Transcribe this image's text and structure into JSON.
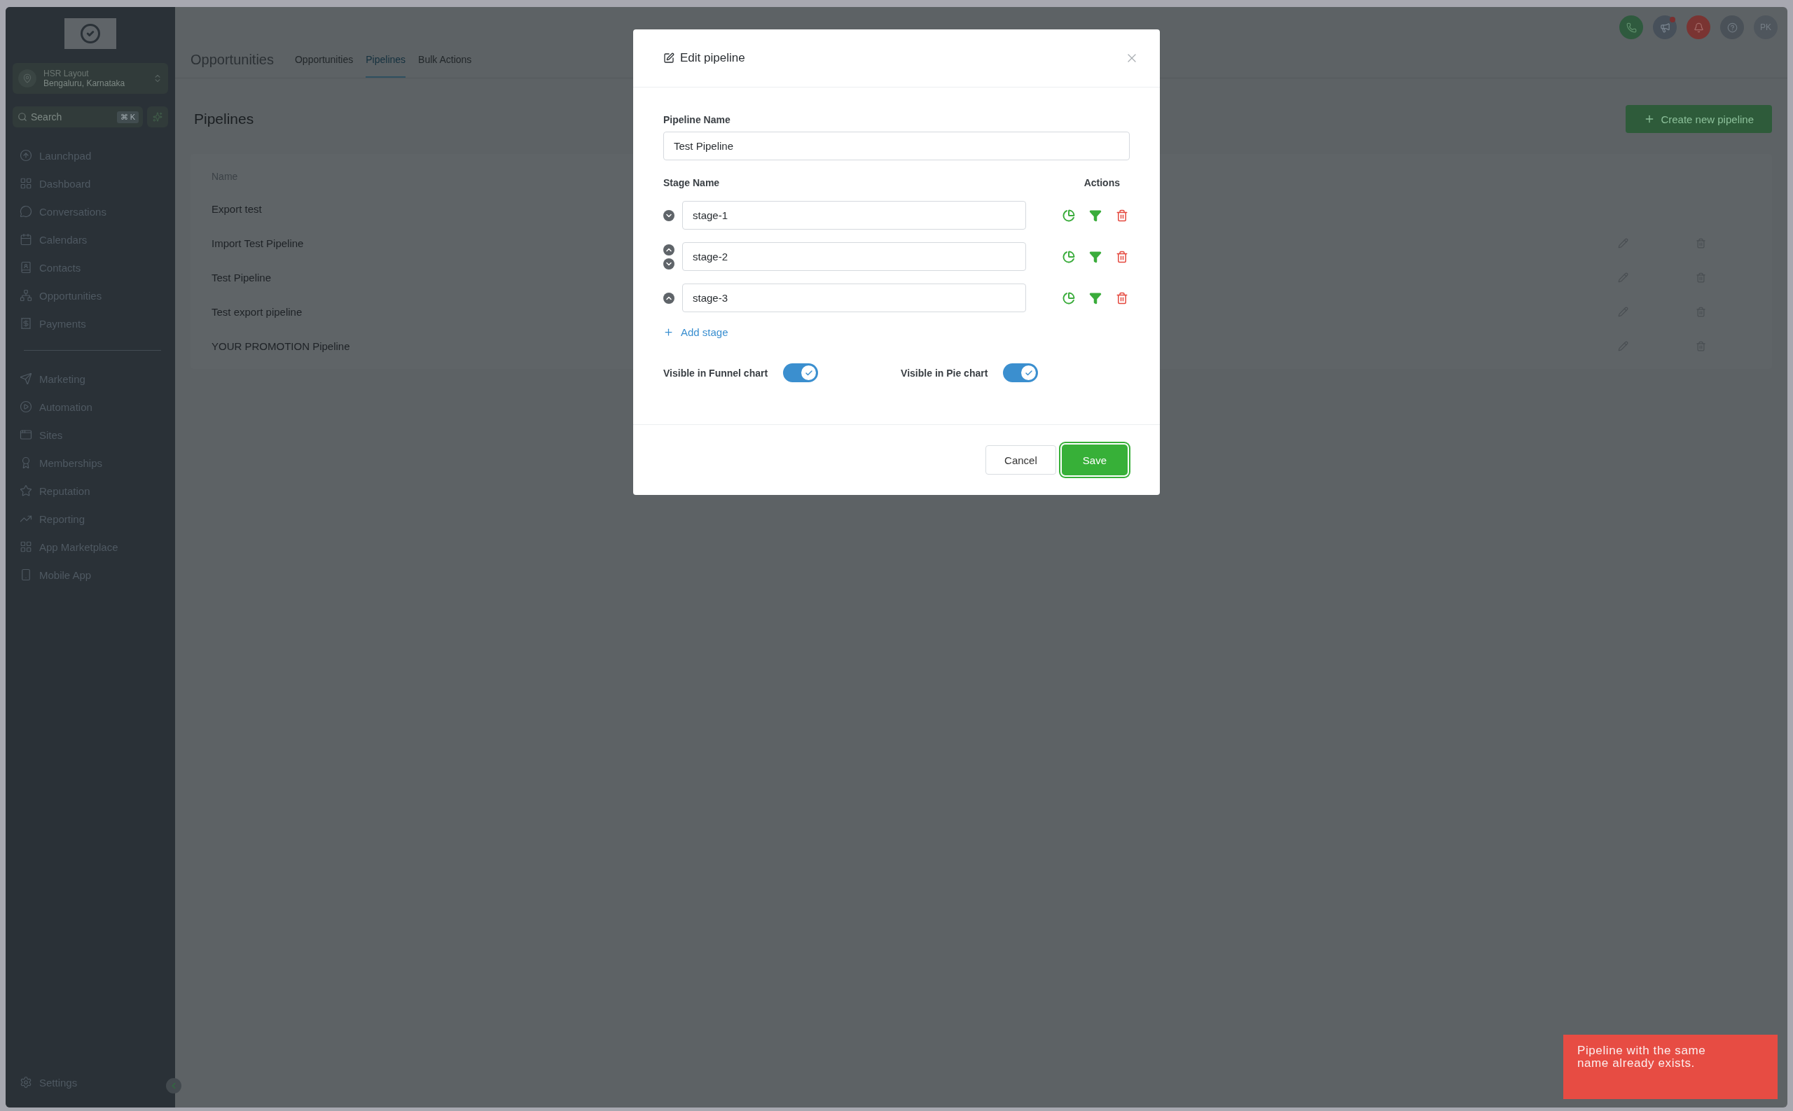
{
  "sidebar": {
    "location": {
      "name": "HSR Layout",
      "subtitle": "Bengaluru, Karnataka"
    },
    "search": {
      "placeholder": "Search",
      "shortcut": "⌘ K"
    },
    "nav_groups": [
      [
        {
          "label": "Launchpad"
        },
        {
          "label": "Dashboard"
        },
        {
          "label": "Conversations"
        },
        {
          "label": "Calendars"
        },
        {
          "label": "Contacts"
        },
        {
          "label": "Opportunities"
        },
        {
          "label": "Payments"
        }
      ],
      [
        {
          "label": "Marketing"
        },
        {
          "label": "Automation"
        },
        {
          "label": "Sites"
        },
        {
          "label": "Memberships"
        },
        {
          "label": "Reputation"
        },
        {
          "label": "Reporting"
        },
        {
          "label": "App Marketplace"
        },
        {
          "label": "Mobile App"
        }
      ]
    ],
    "settings": "Settings"
  },
  "header": {
    "title": "Opportunities",
    "tabs": [
      {
        "label": "Opportunities",
        "selected": false
      },
      {
        "label": "Pipelines",
        "selected": true
      },
      {
        "label": "Bulk Actions",
        "selected": false
      }
    ],
    "avatar": "PK"
  },
  "page": {
    "title": "Pipelines",
    "create_button": "Create new pipeline",
    "table": {
      "columns": [
        "Name"
      ],
      "rows": [
        {
          "name": "Export test",
          "editable": false
        },
        {
          "name": "Import Test Pipeline",
          "editable": true
        },
        {
          "name": "Test Pipeline",
          "editable": true
        },
        {
          "name": "Test export pipeline",
          "editable": true
        },
        {
          "name": "YOUR PROMOTION Pipeline",
          "editable": true
        }
      ]
    }
  },
  "dialog": {
    "title": "Edit pipeline",
    "name_label": "Pipeline Name",
    "name_value": "Test Pipeline",
    "stage_label": "Stage Name",
    "actions_label": "Actions",
    "stages": [
      {
        "value": "stage-1"
      },
      {
        "value": "stage-2"
      },
      {
        "value": "stage-3"
      }
    ],
    "add_stage": "Add stage",
    "toggles": [
      {
        "label": "Visible in Funnel chart",
        "on": true
      },
      {
        "label": "Visible in Pie chart",
        "on": true
      }
    ],
    "cancel": "Cancel",
    "save": "Save"
  },
  "toast": {
    "message": "Pipeline with the same name already exists."
  }
}
